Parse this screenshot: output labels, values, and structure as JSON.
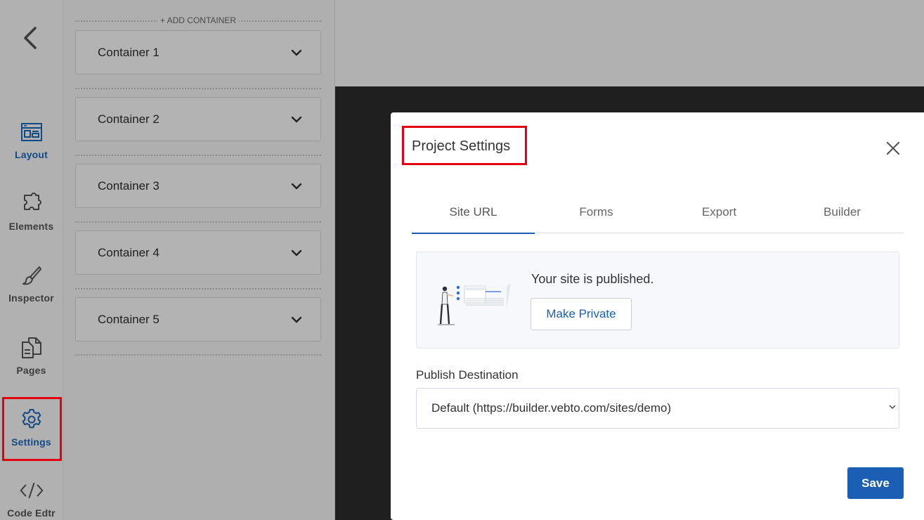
{
  "rail": {
    "items": [
      {
        "label": "Layout",
        "icon": "layout-icon"
      },
      {
        "label": "Elements",
        "icon": "puzzle-icon"
      },
      {
        "label": "Inspector",
        "icon": "brush-icon"
      },
      {
        "label": "Pages",
        "icon": "pages-icon"
      },
      {
        "label": "Settings",
        "icon": "gear-icon"
      },
      {
        "label": "Code Edtr",
        "icon": "code-icon"
      }
    ],
    "active": "Settings"
  },
  "panel": {
    "add_container_label": "+ ADD CONTAINER",
    "containers": [
      "Container 1",
      "Container 2",
      "Container 3",
      "Container 4",
      "Container 5"
    ]
  },
  "modal": {
    "title": "Project Settings",
    "tabs": [
      "Site URL",
      "Forms",
      "Export",
      "Builder"
    ],
    "active_tab": "Site URL",
    "status": {
      "text": "Your site is published.",
      "button_label": "Make Private"
    },
    "destination": {
      "label": "Publish Destination",
      "selected": "Default (https://builder.vebto.com/sites/demo)"
    },
    "save_label": "Save"
  },
  "colors": {
    "accent": "#1a5fb4",
    "highlight": "#e3000f",
    "rail_active_text": "#124a86"
  }
}
